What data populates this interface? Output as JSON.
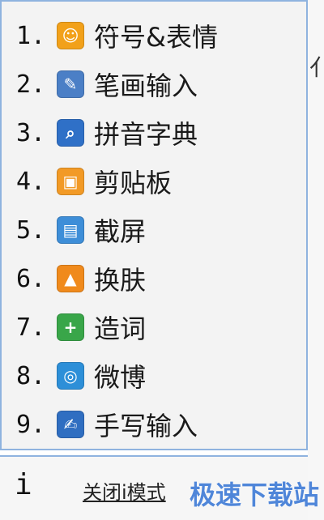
{
  "menu": {
    "items": [
      {
        "num": "1.",
        "label": "符号&表情",
        "icon": "smiley-icon",
        "color": "#f2a11a"
      },
      {
        "num": "2.",
        "label": "笔画输入",
        "icon": "pen-stroke-icon",
        "color": "#4b7fc6"
      },
      {
        "num": "3.",
        "label": "拼音字典",
        "icon": "dictionary-search-icon",
        "color": "#2f70c7"
      },
      {
        "num": "4.",
        "label": "剪贴板",
        "icon": "clipboard-icon",
        "color": "#f29a26"
      },
      {
        "num": "5.",
        "label": "截屏",
        "icon": "screenshot-icon",
        "color": "#3e8ed8"
      },
      {
        "num": "6.",
        "label": "换肤",
        "icon": "skin-shirt-icon",
        "color": "#f08a1c"
      },
      {
        "num": "7.",
        "label": "造词",
        "icon": "word-create-icon",
        "color": "#39a649"
      },
      {
        "num": "8.",
        "label": "微博",
        "icon": "weibo-icon",
        "color": "#2d8fd8"
      },
      {
        "num": "9.",
        "label": "手写输入",
        "icon": "handwriting-icon",
        "color": "#2f6ec1"
      }
    ]
  },
  "footer": {
    "ime_letter": "i",
    "close_label": "关闭i模式"
  },
  "background": {
    "right_fragment": "亻"
  },
  "watermark": {
    "text": "极速下载站"
  }
}
